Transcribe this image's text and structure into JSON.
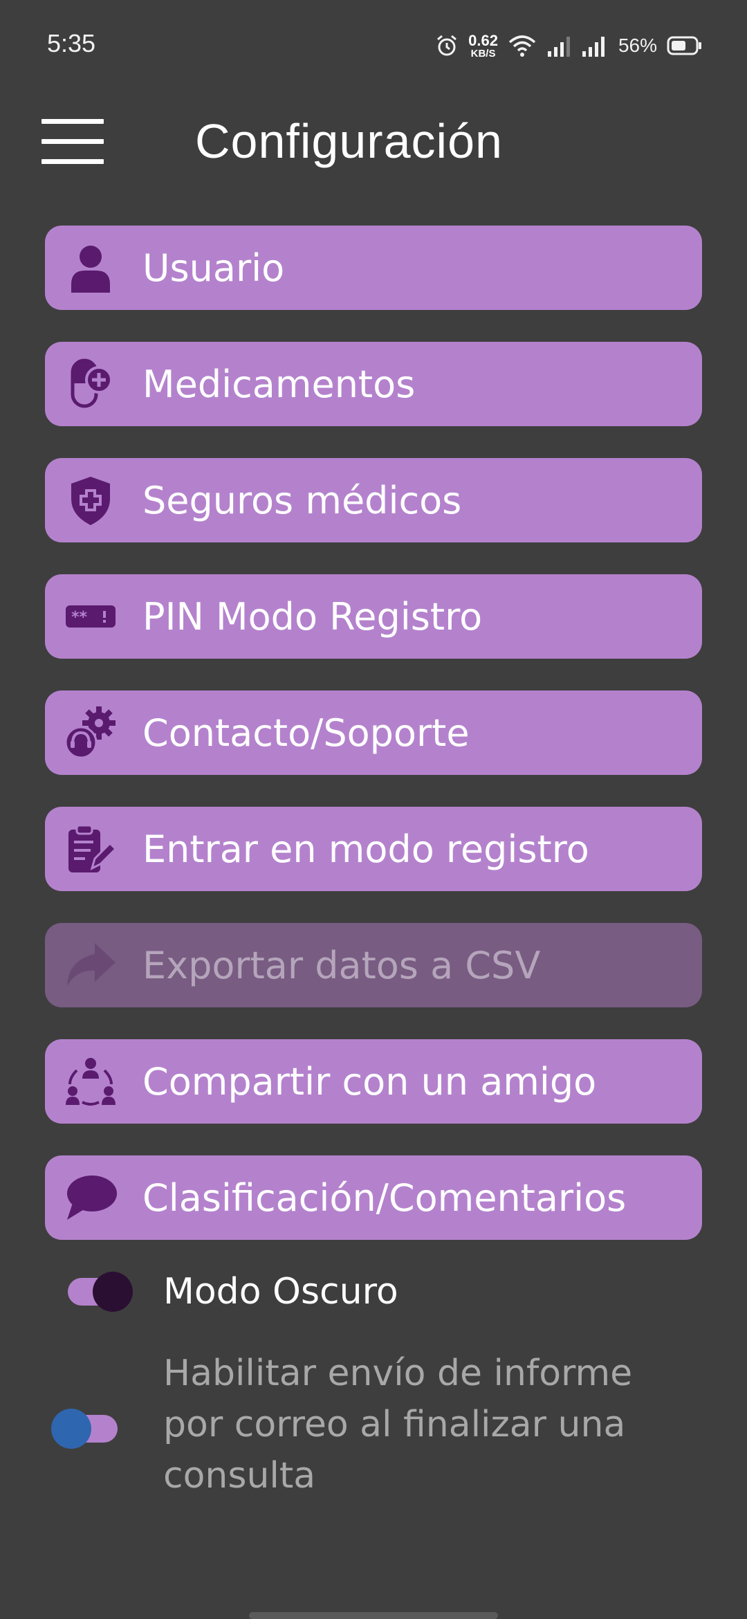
{
  "status_bar": {
    "time": "5:35",
    "net_speed_value": "0.62",
    "net_speed_unit": "KB/S",
    "battery": "56%"
  },
  "header": {
    "title": "Configuración"
  },
  "menu": {
    "items": [
      {
        "label": "Usuario",
        "icon": "user-icon",
        "enabled": true
      },
      {
        "label": "Medicamentos",
        "icon": "pill-icon",
        "enabled": true
      },
      {
        "label": "Seguros médicos",
        "icon": "shield-plus-icon",
        "enabled": true
      },
      {
        "label": "PIN Modo Registro",
        "icon": "password-icon",
        "enabled": true
      },
      {
        "label": "Contacto/Soporte",
        "icon": "support-gear-icon",
        "enabled": true
      },
      {
        "label": "Entrar en modo registro",
        "icon": "clipboard-edit-icon",
        "enabled": true
      },
      {
        "label": "Exportar datos a CSV",
        "icon": "share-arrow-icon",
        "enabled": false
      },
      {
        "label": "Compartir con un amigo",
        "icon": "people-share-icon",
        "enabled": true
      },
      {
        "label": "Clasificación/Comentarios",
        "icon": "chat-bubble-icon",
        "enabled": true
      }
    ]
  },
  "toggles": {
    "dark_mode": {
      "label": "Modo Oscuro",
      "on": true
    },
    "email_report": {
      "label": "Habilitar envío de informe por correo al finalizar una consulta",
      "on": false
    }
  },
  "colors": {
    "background": "#3e3e3e",
    "item_bg": "#b482cd",
    "item_bg_disabled": "#785c82",
    "icon_dark": "#5a1a6e",
    "toggle_thumb_on": "#2a0f33",
    "toggle_thumb_off": "#2f66b0"
  }
}
